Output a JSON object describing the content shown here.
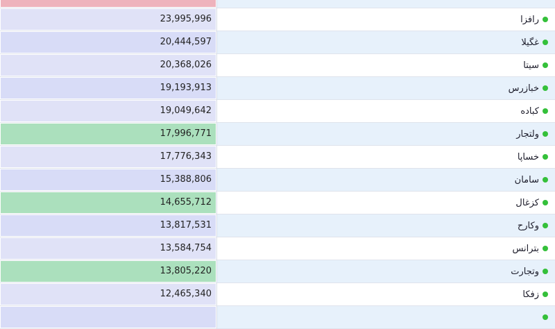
{
  "status_color": "#34c03a",
  "colors": {
    "name_stripe_a": "#e7f1fb",
    "name_stripe_b": "#ffffff",
    "value_neutral": "#e0e2f7",
    "value_neutral_alt": "#d8dcf7",
    "value_up": "#abe0bd",
    "value_down": "#eeb3bc"
  },
  "rows": [
    {
      "name": "",
      "value": "",
      "tone": "down"
    },
    {
      "name": "رافزا",
      "value": "23,995,996",
      "tone": "neutral"
    },
    {
      "name": "غگیلا",
      "value": "20,444,597",
      "tone": "neutral_alt"
    },
    {
      "name": "سیتا",
      "value": "20,368,026",
      "tone": "neutral"
    },
    {
      "name": "خبازرس",
      "value": "19,193,913",
      "tone": "neutral_alt"
    },
    {
      "name": "کباده",
      "value": "19,049,642",
      "tone": "neutral"
    },
    {
      "name": "ولتجار",
      "value": "17,996,771",
      "tone": "up"
    },
    {
      "name": "خساپا",
      "value": "17,776,343",
      "tone": "neutral"
    },
    {
      "name": "سامان",
      "value": "15,388,806",
      "tone": "neutral_alt"
    },
    {
      "name": "کزغال",
      "value": "14,655,712",
      "tone": "up"
    },
    {
      "name": "وکارح",
      "value": "13,817,531",
      "tone": "neutral_alt"
    },
    {
      "name": "بترانس",
      "value": "13,584,754",
      "tone": "neutral"
    },
    {
      "name": "وتجارت",
      "value": "13,805,220",
      "tone": "up"
    },
    {
      "name": "زفکا",
      "value": "12,465,340",
      "tone": "neutral"
    },
    {
      "name": "",
      "value": "",
      "tone": "neutral_alt"
    }
  ]
}
